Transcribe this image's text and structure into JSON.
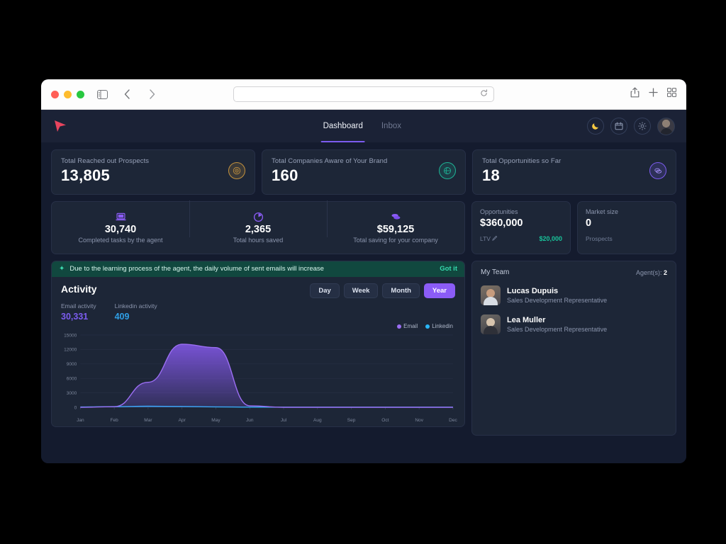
{
  "browser": {
    "url_value": "",
    "url_placeholder": "",
    "reload_icon": "reload-icon",
    "sidebar_icon": "sidebar-toggle-icon",
    "back_icon": "back-chevron-icon",
    "forward_icon": "forward-chevron-icon",
    "share_icon": "share-icon",
    "new_tab_icon": "plus-icon",
    "tab_overview_icon": "tab-grid-icon"
  },
  "header": {
    "logo": "cursor-logo",
    "tabs": [
      {
        "label": "Dashboard",
        "active": true
      },
      {
        "label": "Inbox",
        "active": false
      }
    ],
    "icons": [
      {
        "name": "moon-icon",
        "color": "#f5c842"
      },
      {
        "name": "calendar-icon",
        "color": "#8e99b2"
      },
      {
        "name": "gear-icon",
        "color": "#8e99b2"
      }
    ],
    "avatar": "user-avatar"
  },
  "kpis": [
    {
      "label": "Total Reached out Prospects",
      "value": "13,805",
      "badge": "target-icon",
      "badge_color": "#c4923e"
    },
    {
      "label": "Total Companies Aware of Your Brand",
      "value": "160",
      "badge": "globe-icon",
      "badge_color": "#1eb496"
    },
    {
      "label": "Total Opportunities so Far",
      "value": "18",
      "badge": "coins-icon",
      "badge_color": "#7c5cf0"
    }
  ],
  "agent_stats": [
    {
      "icon": "laptop-icon",
      "value": "30,740",
      "label": "Completed tasks by the agent"
    },
    {
      "icon": "clock-icon",
      "value": "2,365",
      "label": "Total hours saved"
    },
    {
      "icon": "coins-stack-icon",
      "value": "$59,125",
      "label": "Total saving for your company"
    }
  ],
  "opportunities_card": {
    "label": "Opportunities",
    "value": "$360,000",
    "foot_label": "LTV",
    "foot_icon": "pencil-edit-icon",
    "foot_amount": "$20,000",
    "foot_amount_color": "#18c39a"
  },
  "market_card": {
    "label": "Market size",
    "value": "0",
    "foot_label": "Prospects"
  },
  "banner": {
    "icon": "sparkle-icon",
    "message": "Due to the learning process of the agent, the daily volume of sent emails will increase",
    "action": "Got it",
    "background": "#11483f",
    "accent": "#36dbae"
  },
  "activity": {
    "title": "Activity",
    "ranges": [
      {
        "label": "Day",
        "active": false
      },
      {
        "label": "Week",
        "active": false
      },
      {
        "label": "Month",
        "active": false
      },
      {
        "label": "Year",
        "active": true
      }
    ],
    "metrics": [
      {
        "label": "Email activity",
        "value": "30,331",
        "color": "#7c5cf0"
      },
      {
        "label": "Linkedin activity",
        "value": "409",
        "color": "#2f9fe6"
      }
    ]
  },
  "chart_data": {
    "type": "area",
    "title": "Activity",
    "xlabel": "",
    "ylabel": "",
    "ylim": [
      0,
      15000
    ],
    "yticks": [
      0,
      3000,
      6000,
      9000,
      12000,
      15000
    ],
    "ytick_labels": [
      "0",
      "3000",
      "6000",
      "9000",
      "12000",
      "15000"
    ],
    "grid": true,
    "legend_position": "top-right",
    "categories": [
      "Jan",
      "Feb",
      "Mar",
      "Apr",
      "May",
      "Jun",
      "Jul",
      "Aug",
      "Sep",
      "Oct",
      "Nov",
      "Dec"
    ],
    "series": [
      {
        "name": "Email",
        "color": "#9b6ef3",
        "values": [
          0,
          120,
          5200,
          13100,
          12400,
          300,
          0,
          0,
          0,
          0,
          0,
          0
        ]
      },
      {
        "name": "Linkedin",
        "color": "#29b6f6",
        "values": [
          60,
          140,
          220,
          180,
          90,
          40,
          30,
          30,
          30,
          30,
          30,
          30
        ]
      }
    ]
  },
  "team": {
    "title": "My Team",
    "count_label": "Agent(s):",
    "count_value": "2",
    "members": [
      {
        "name": "Lucas Dupuis",
        "role": "Sales Development Representative",
        "avatar": "avatar-lucas"
      },
      {
        "name": "Lea Muller",
        "role": "Sales Development Representative",
        "avatar": "avatar-lea"
      }
    ]
  }
}
